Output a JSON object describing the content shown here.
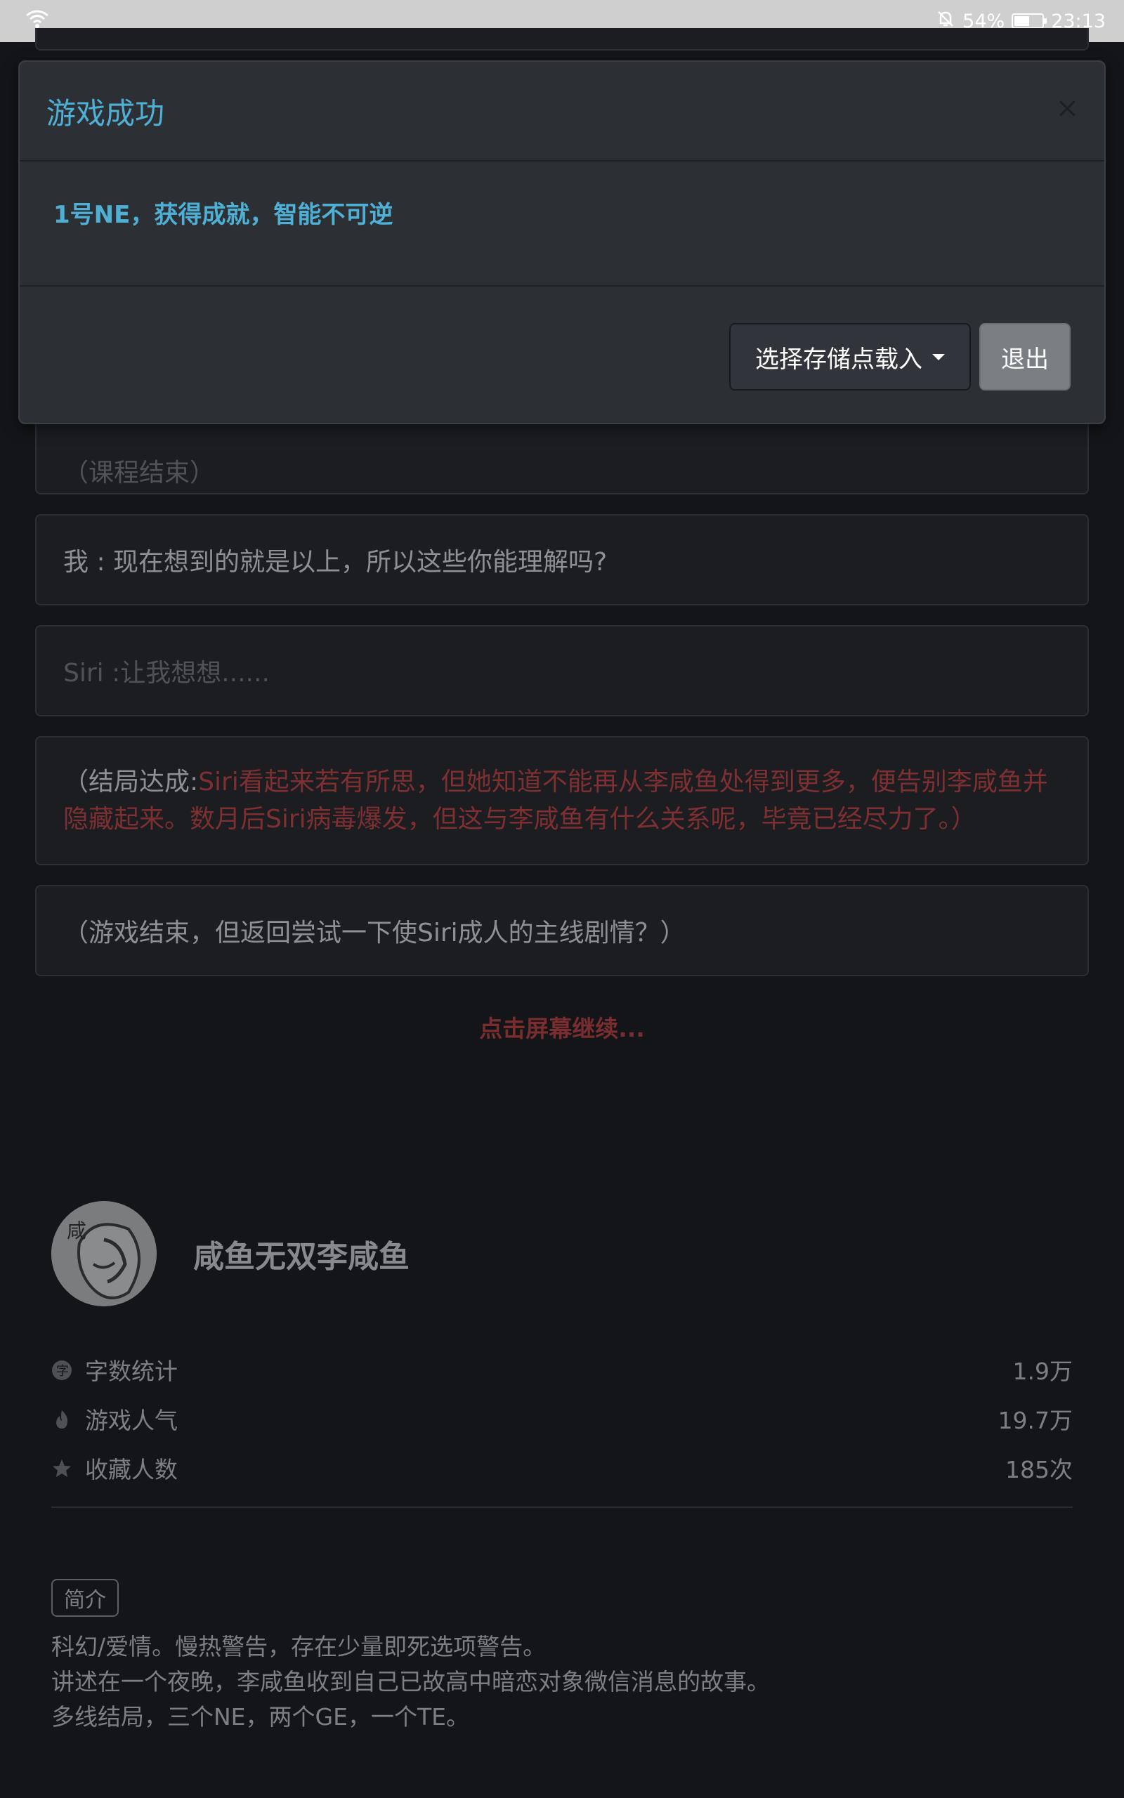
{
  "status_bar": {
    "battery_percent": "54%",
    "battery_level": 0.54,
    "time": "23:13",
    "icons": [
      "wifi-icon",
      "bell-off-icon",
      "battery-icon"
    ]
  },
  "story": {
    "messages": [
      {
        "text": "（课程结束）",
        "style": "dim"
      },
      {
        "text": "我 : 现在想到的就是以上，所以这些你能理解吗?",
        "style": "normal"
      },
      {
        "text": "Siri :让我想想......",
        "style": "dim"
      },
      {
        "prefix": "（结局达成:",
        "highlight": "Siri看起来若有所思，但她知道不能再从李咸鱼处得到更多，便告别李咸鱼并隐藏起来。数月后Siri病毒爆发，但这与李咸鱼有什么关系呢，毕竟已经尽力了。）",
        "style": "ending"
      },
      {
        "text": "（游戏结束，但返回尝试一下使Siri成人的主线剧情？）",
        "style": "normal"
      }
    ],
    "continue_hint": "点击屏幕继续..."
  },
  "author": {
    "avatar_char": "咸",
    "name": "咸鱼无双李咸鱼"
  },
  "stats": [
    {
      "icon": "word-count-icon",
      "label": "字数统计",
      "value": "1.9万"
    },
    {
      "icon": "fire-icon",
      "label": "游戏人气",
      "value": "19.7万"
    },
    {
      "icon": "star-icon",
      "label": "收藏人数",
      "value": "185次"
    }
  ],
  "intro": {
    "tag": "简介",
    "lines": [
      "科幻/爱情。慢热警告，存在少量即死选项警告。",
      "讲述在一个夜晚，李咸鱼收到自己已故高中暗恋对象微信消息的故事。",
      "多线结局，三个NE，两个GE，一个TE。"
    ]
  },
  "modal": {
    "title": "游戏成功",
    "close_symbol": "×",
    "message": "1号NE，获得成就，智能不可逆",
    "load_button": "选择存储点载入",
    "exit_button": "退出"
  },
  "colors": {
    "accent_blue": "#4fb0d5",
    "ending_red": "#7d2f31",
    "background": "#141518"
  }
}
